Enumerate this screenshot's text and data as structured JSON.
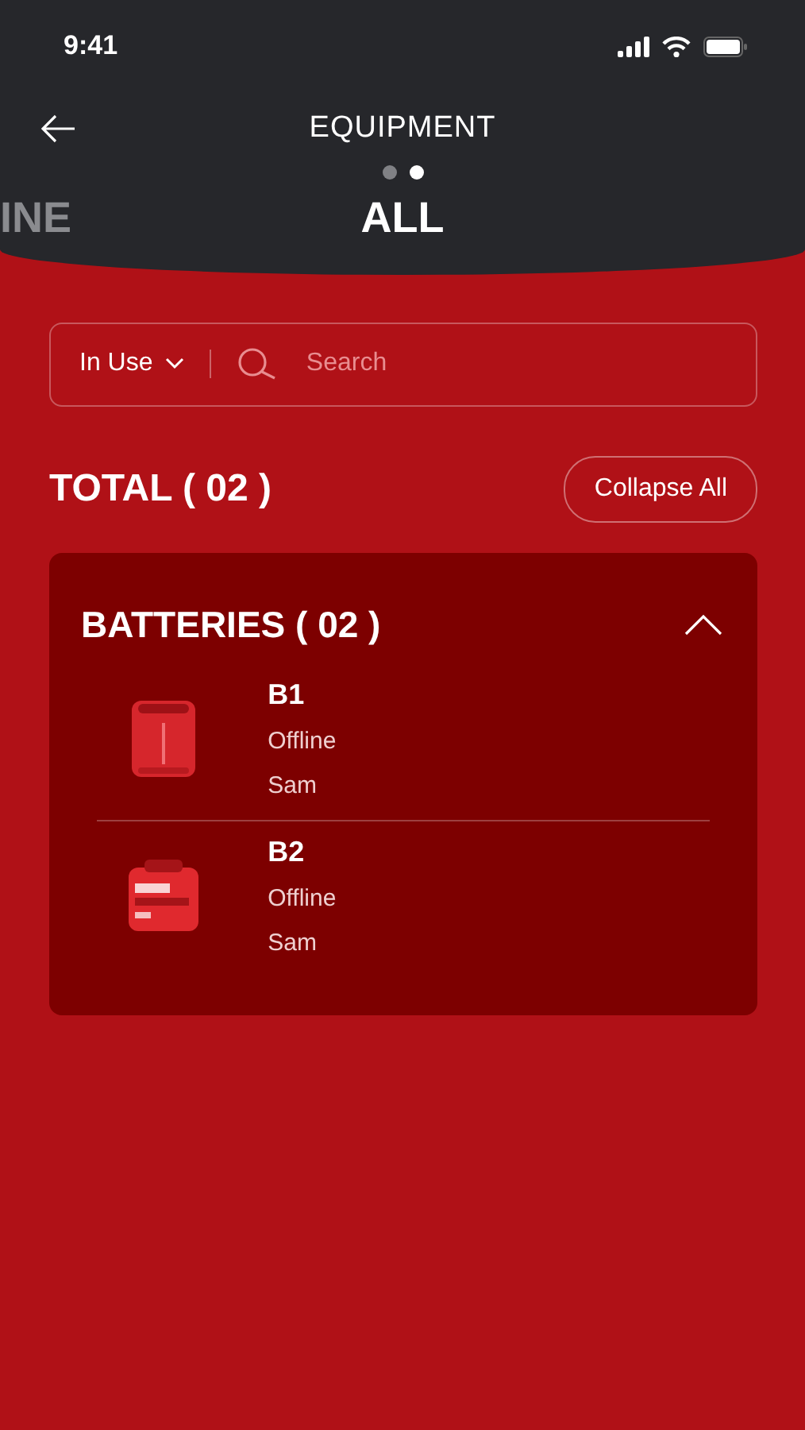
{
  "status_bar": {
    "time": "9:41"
  },
  "header": {
    "title": "EQUIPMENT"
  },
  "pages": [
    {
      "selected": false
    },
    {
      "selected": true
    }
  ],
  "tabs": [
    {
      "label": "INE",
      "selected": false
    },
    {
      "label": "ALL",
      "selected": true
    }
  ],
  "filter": {
    "value": "In Use"
  },
  "search": {
    "placeholder": "Search"
  },
  "total": "TOTAL ( 02 )",
  "collapse_button": "Collapse All",
  "groups": [
    {
      "title": "BATTERIES ( 02 )",
      "expanded": true,
      "items": [
        {
          "name": "B1",
          "status": "Offline",
          "user": "Sam",
          "kind": "picture"
        },
        {
          "name": "B2",
          "status": "Offline",
          "user": "Sam",
          "kind": "picture"
        }
      ]
    }
  ]
}
